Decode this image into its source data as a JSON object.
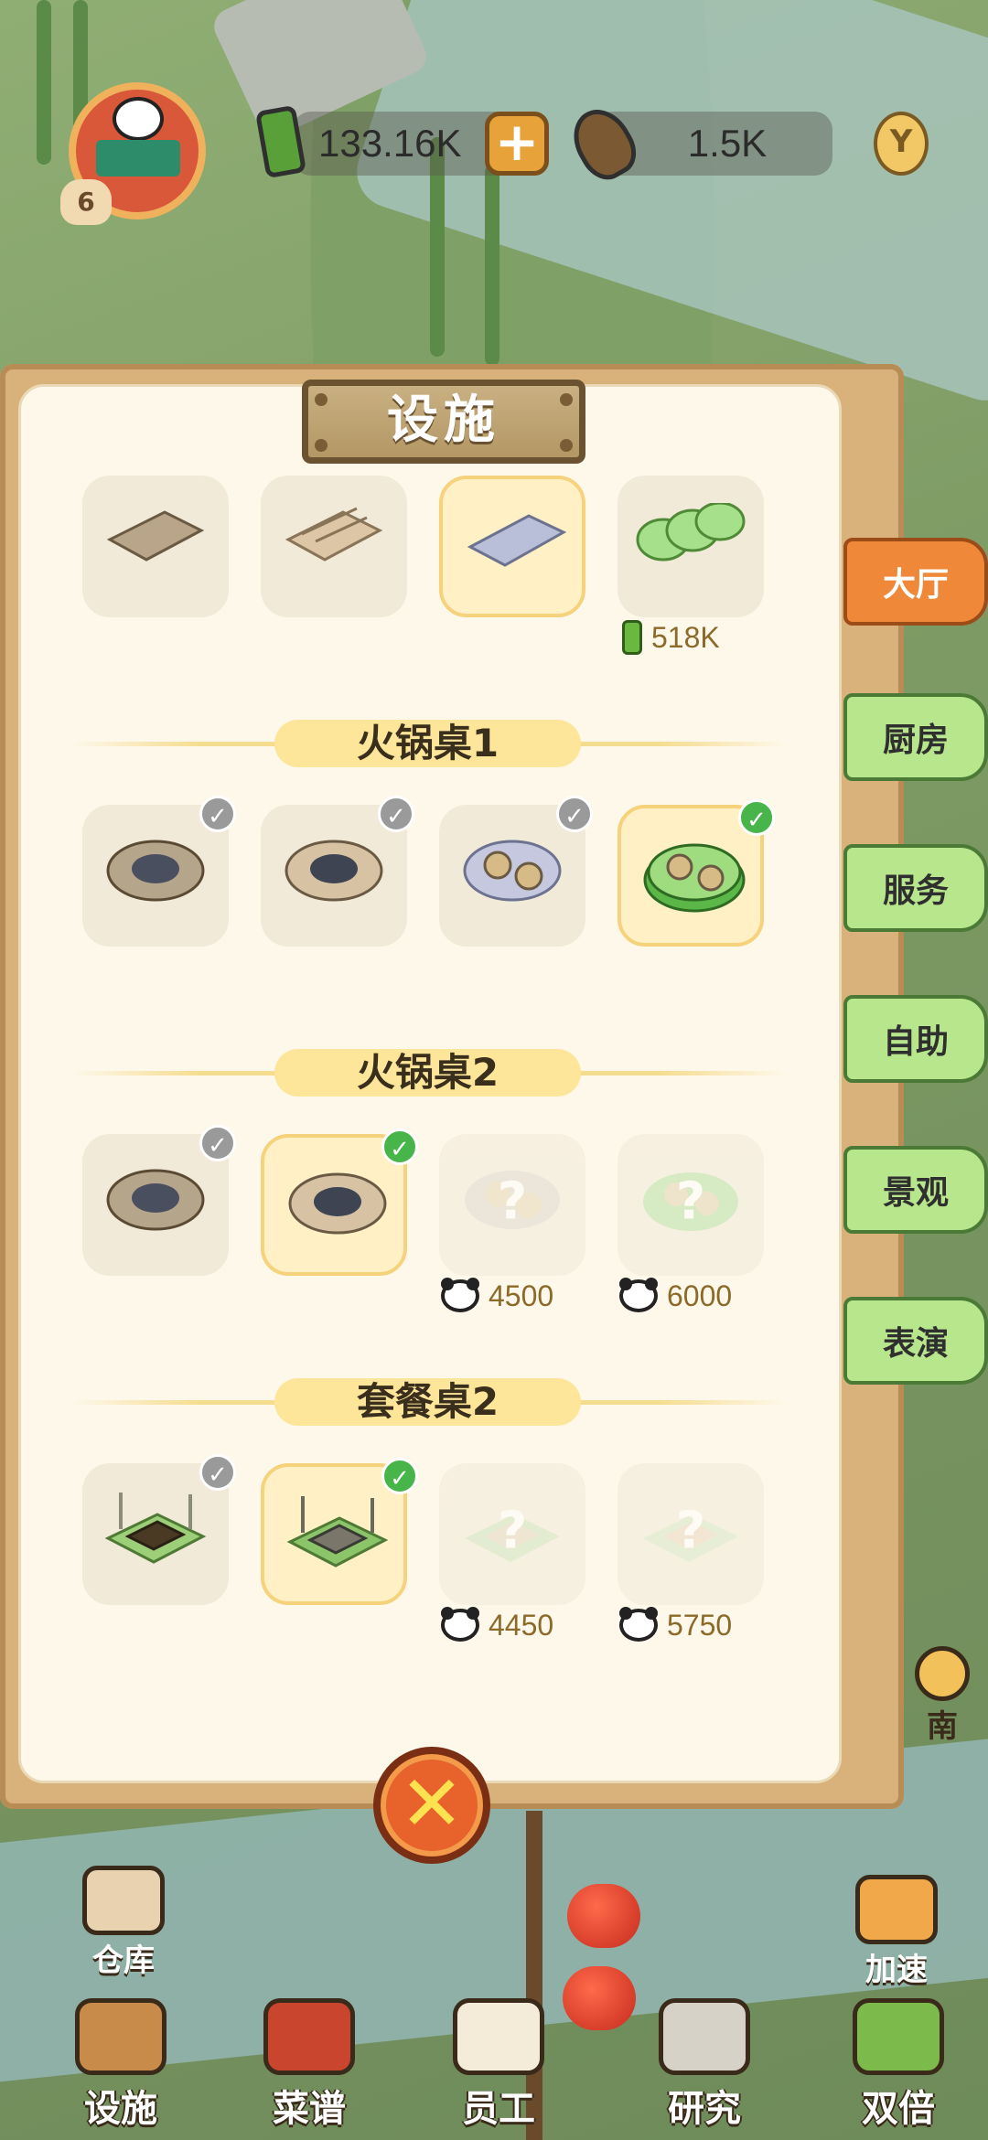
{
  "hud": {
    "level": "6",
    "bamboo_amount": "133.16K",
    "bamboo_shoot_amount": "1.5K",
    "hint_icon": "lightbulb-icon"
  },
  "panel": {
    "title": "设施",
    "close_icon": "close-x-icon",
    "top_row": {
      "price": "518K"
    },
    "sections": [
      {
        "title": "火锅桌1"
      },
      {
        "title": "火锅桌2",
        "prices": [
          "4500",
          "6000"
        ]
      },
      {
        "title": "套餐桌2",
        "prices": [
          "4450",
          "5750"
        ]
      }
    ],
    "locked_mark": "?"
  },
  "side_tabs": [
    "大厅",
    "厨房",
    "服务",
    "自助",
    "景观",
    "表演"
  ],
  "active_tab": "大厅",
  "scene_buttons": {
    "warehouse": "仓库",
    "speed_up": "加速",
    "guide_partial": "南"
  },
  "bottom_nav": [
    "设施",
    "菜谱",
    "员工",
    "研究",
    "双倍"
  ],
  "colors": {
    "paper": "#fdf8ea",
    "active_tab": "#f0883a",
    "inactive_tab": "#b8e68c",
    "check_owned": "#9a9a9a",
    "check_equipped": "#47b54a",
    "section_header": "#fde59a"
  }
}
